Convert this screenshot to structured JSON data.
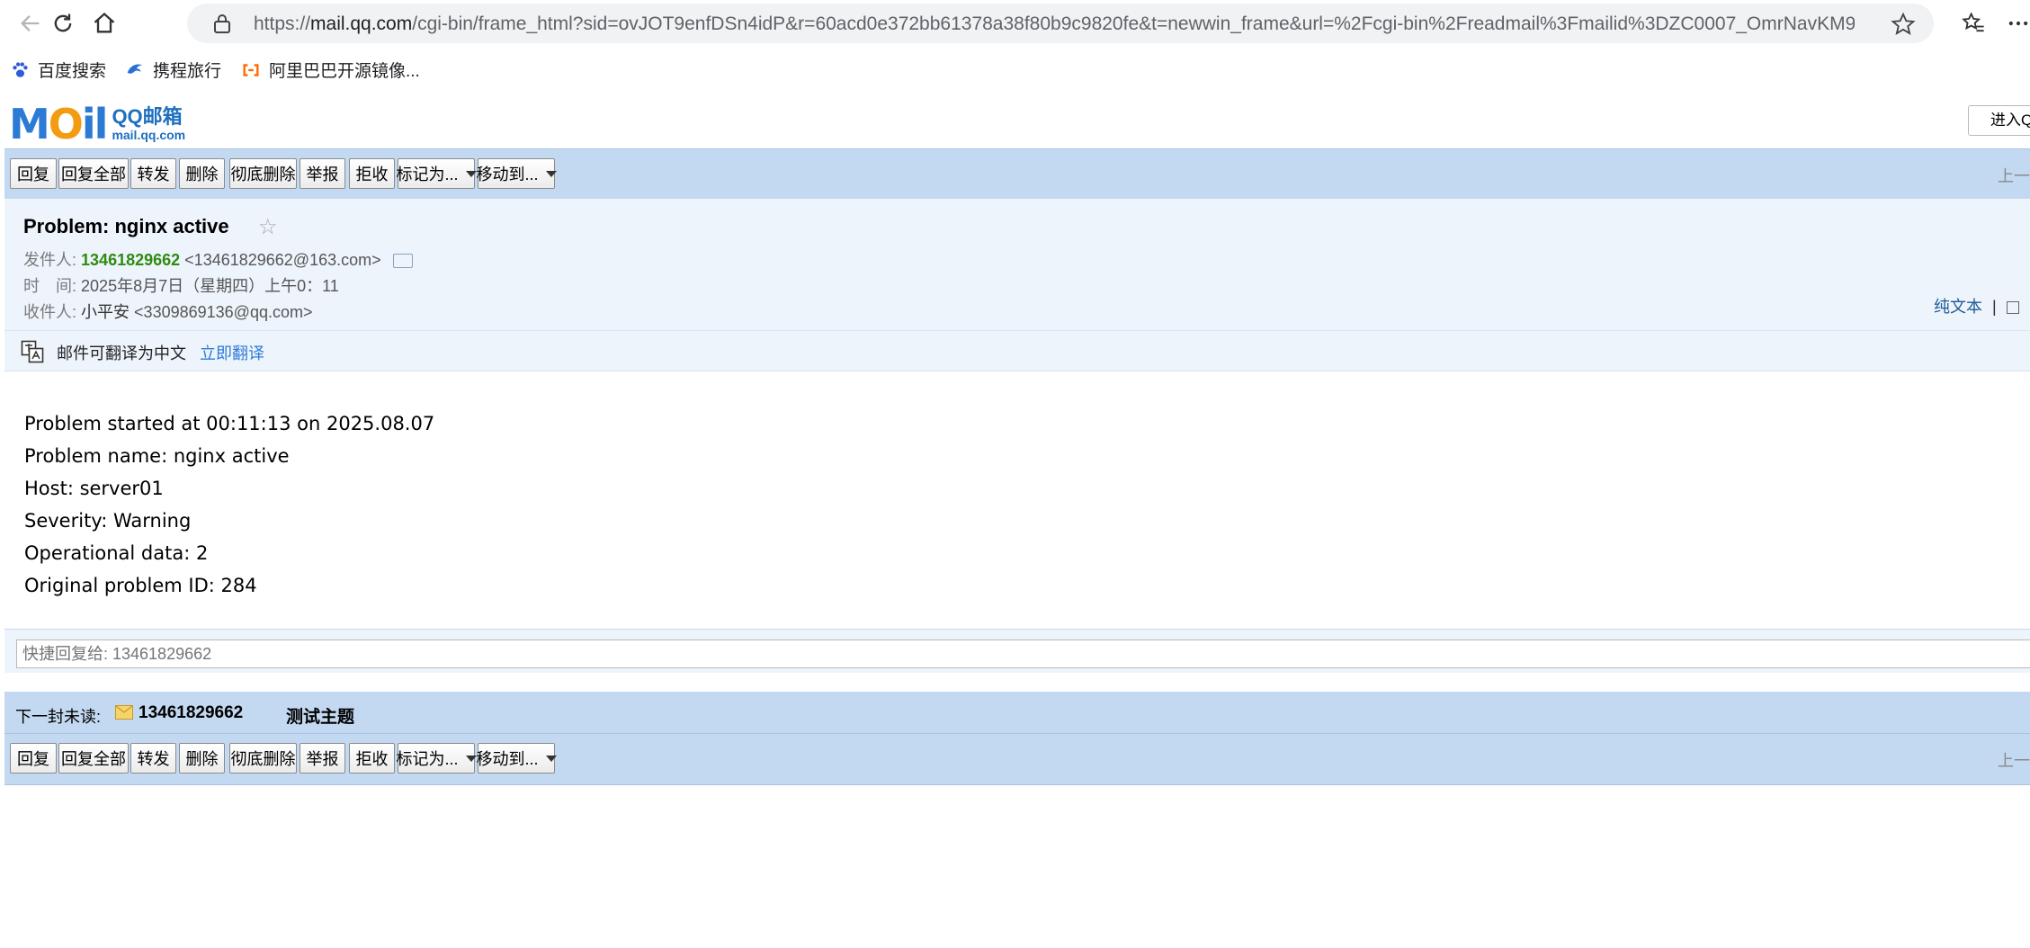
{
  "browser": {
    "url_prefix": "https://",
    "url_host": "mail.qq.com",
    "url_rest": "/cgi-bin/frame_html?sid=ovJOT9enfDSn4idP&r=60acd0e372bb61378a38f80b9c9820fe&t=newwin_frame&url=%2Fcgi-bin%2Freadmail%3Fmailid%3DZC0007_OmrNavKM9...",
    "bookmarks": [
      {
        "label": "百度搜索",
        "icon": "paw-icon"
      },
      {
        "label": "携程旅行",
        "icon": "dolphin-icon"
      },
      {
        "label": "阿里巴巴开源镜像...",
        "icon": "aliyun-icon"
      }
    ]
  },
  "logo": {
    "word": "MOil",
    "cn": "QQ邮箱",
    "domain": "mail.qq.com"
  },
  "enter_button": "进入Q",
  "toolbar": {
    "buttons": [
      "回复",
      "回复全部",
      "转发",
      "删除",
      "彻底删除",
      "举报",
      "拒收",
      "标记为...",
      "移动到..."
    ],
    "right_text": "上一封"
  },
  "mail": {
    "subject": "Problem: nginx active",
    "from_label": "发件人:",
    "from_name": "13461829662",
    "from_addr": "<13461829662@163.com>",
    "time_label": "时　间:",
    "time_value": "2025年8月7日（星期四）上午0：11",
    "to_label": "收件人:",
    "to_name": "小平安",
    "to_addr": "<3309869136@qq.com>",
    "plain_text_link": "纯文本",
    "separator": "|"
  },
  "translate": {
    "text": "邮件可翻译为中文",
    "link": "立即翻译"
  },
  "body": [
    "Problem started at 00:11:13 on 2025.08.07",
    "Problem name: nginx active",
    "Host: server01",
    "Severity: Warning",
    "Operational data: 2",
    "Original problem ID: 284"
  ],
  "quick_reply": {
    "placeholder": "快捷回复给: 13461829662"
  },
  "next_unread": {
    "label": "下一封未读:",
    "from": "13461829662",
    "subject": "测试主题"
  },
  "colors": {
    "toolbar_bg": "#c3d9f1",
    "header_bg": "#eef4fc",
    "sender_green": "#2e8b10",
    "link_blue": "#2f7bd8"
  }
}
